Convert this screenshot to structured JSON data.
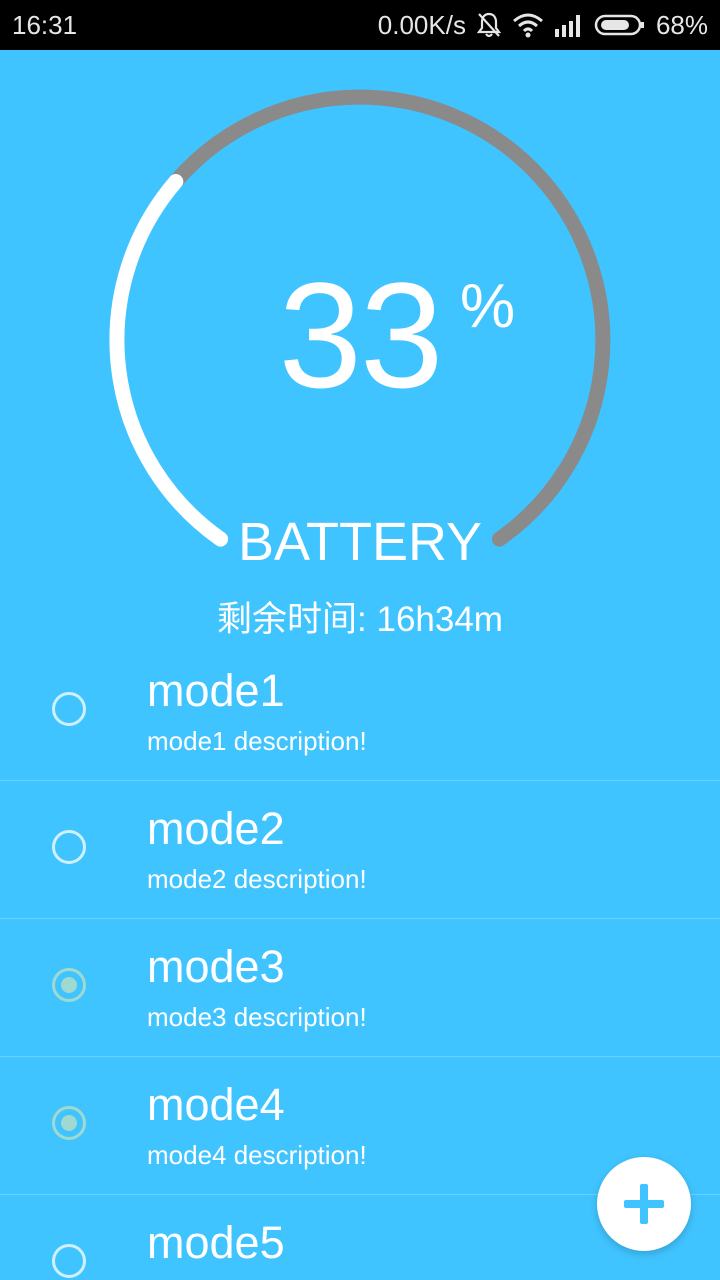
{
  "status_bar": {
    "time": "16:31",
    "network_speed": "0.00K/s",
    "battery_percent": "68%",
    "icons": [
      "bell-muted-icon",
      "wifi-icon",
      "signal-icon",
      "battery-icon"
    ]
  },
  "battery": {
    "level": 33,
    "value": "33",
    "percent_sign": "%",
    "label": "BATTERY",
    "remaining_label": "剩余时间: 16h34m",
    "colors": {
      "progress": "#ffffff",
      "track": "#8a8a8a",
      "background": "#40c4ff"
    }
  },
  "modes": [
    {
      "title": "mode1",
      "description": "mode1 description!",
      "selected": false
    },
    {
      "title": "mode2",
      "description": "mode2 description!",
      "selected": false
    },
    {
      "title": "mode3",
      "description": "mode3 description!",
      "selected": true
    },
    {
      "title": "mode4",
      "description": "mode4 description!",
      "selected": true
    },
    {
      "title": "mode5",
      "description": "",
      "selected": false
    }
  ],
  "fab": {
    "icon": "plus-icon",
    "color": "#40c4ff"
  }
}
